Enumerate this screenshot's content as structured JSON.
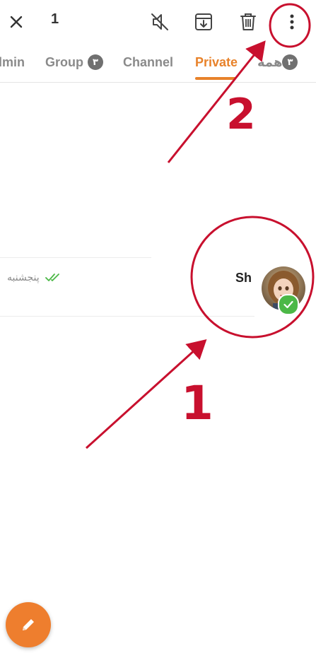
{
  "topbar": {
    "selected_count": "1",
    "icons": [
      "close-icon",
      "mute-icon",
      "archive-icon",
      "delete-icon",
      "more-vertical-icon"
    ]
  },
  "tabs": [
    {
      "label": "lmin",
      "badge": ""
    },
    {
      "label": "Group",
      "badge": "٣"
    },
    {
      "label": "Channel",
      "badge": ""
    },
    {
      "label": "Private",
      "badge": "",
      "active": true
    },
    {
      "label": "همه",
      "badge": "٣"
    }
  ],
  "chat": {
    "name": "Sh",
    "date": "پنجشنبه",
    "status": "read-double-check",
    "selected": true
  },
  "annotations": {
    "step1": "1",
    "step2": "2"
  },
  "colors": {
    "accent": "#e8822a",
    "fab": "#ee7e2e",
    "annotation": "#c8102e",
    "check": "#4cb847",
    "badge": "#707070"
  }
}
